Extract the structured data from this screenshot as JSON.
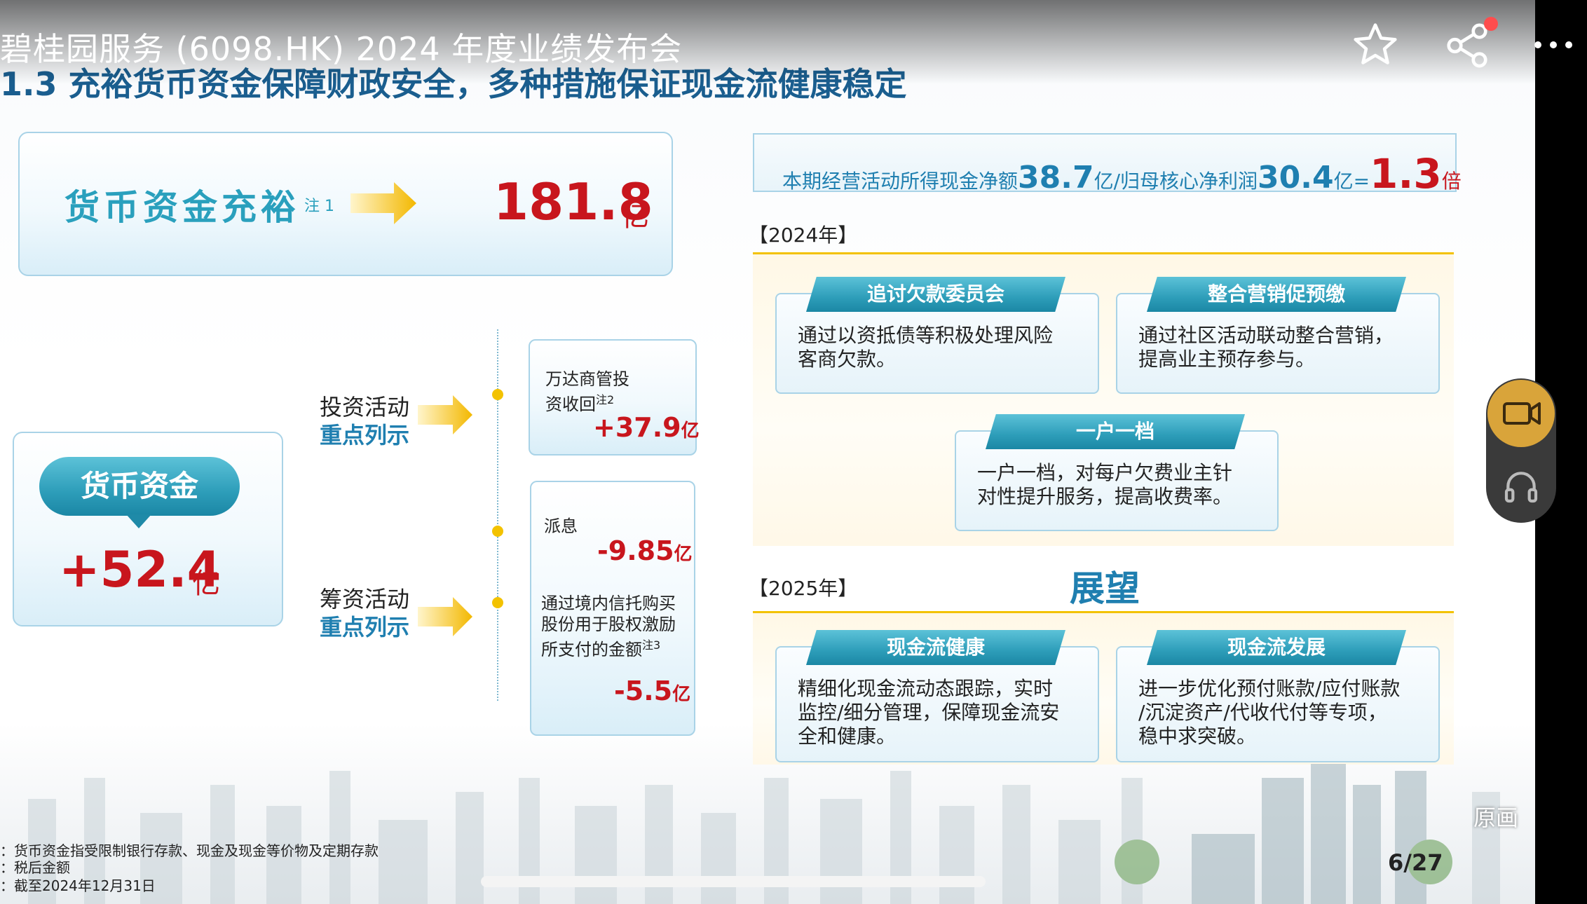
{
  "overlay": {
    "title": "碧桂园服务 (6098.HK) 2024 年度业绩发布会",
    "original_label": "原画",
    "page": "6/27"
  },
  "slide": {
    "heading": "1.3 充裕货币资金保障财政安全，多种措施保证现金流健康稳定",
    "cash_banner": {
      "label": "货币资金充裕",
      "note": "注 1",
      "value": "181.8",
      "unit": "亿"
    },
    "cash_box": {
      "pill": "货币资金",
      "value": "+52.4",
      "unit": "亿"
    },
    "invest": {
      "line1": "投资活动",
      "line2": "重点列示"
    },
    "finance": {
      "line1": "筹资活动",
      "line2": "重点列示"
    },
    "wanda": {
      "text1": "万达商管投",
      "text2": "资收回",
      "note": "注2",
      "value": "+37.9",
      "unit": "亿"
    },
    "dividend": {
      "label": "派息",
      "value": "-9.85",
      "unit": "亿"
    },
    "trust": {
      "line1": "通过境内信托购买",
      "line2": "股份用于股权激励",
      "line3": "所支付的金额",
      "note": "注3",
      "value": "-5.5",
      "unit": "亿"
    },
    "ratio": {
      "prefix": "本期经营活动所得现金净额",
      "v1": "38.7",
      "mid": "亿/归母核心净利润",
      "v2": "30.4",
      "eq": "亿=",
      "v3": "1.3",
      "suffix": "倍"
    },
    "year2024": "【2024年】",
    "year2025": "【2025年】",
    "outlook": "展望",
    "cards2024": [
      {
        "title": "追讨欠款委员会",
        "l1": "通过以资抵债等积极处理风险",
        "l2": "客商欠款。"
      },
      {
        "title": "整合营销促预缴",
        "l1": "通过社区活动联动整合营销，",
        "l2": "提高业主预存参与。"
      },
      {
        "title": "一户一档",
        "l1": "一户一档，对每户欠费业主针",
        "l2": "对性提升服务，提高收费率。"
      }
    ],
    "cards2025": [
      {
        "title": "现金流健康",
        "l1": "精细化现金流动态跟踪，实时",
        "l2": "监控/细分管理，保障现金流安",
        "l3": "全和健康。"
      },
      {
        "title": "现金流发展",
        "l1": "进一步优化预付账款/应付账款",
        "l2": "/沉淀资产/代收代付等专项，",
        "l3": "稳中求突破。"
      }
    ],
    "footnotes": [
      "：货币资金指受限制银行存款、现金及现金等价物及定期存款",
      "：税后金额",
      "：截至2024年12月31日"
    ]
  },
  "icons": [
    "star-icon",
    "share-icon",
    "more-icon",
    "camera-icon",
    "headphones-icon"
  ],
  "colors": {
    "accent": "#2a98b8",
    "red": "#c8161d",
    "yellow": "#f3c200",
    "blue": "#1f7fb0"
  }
}
